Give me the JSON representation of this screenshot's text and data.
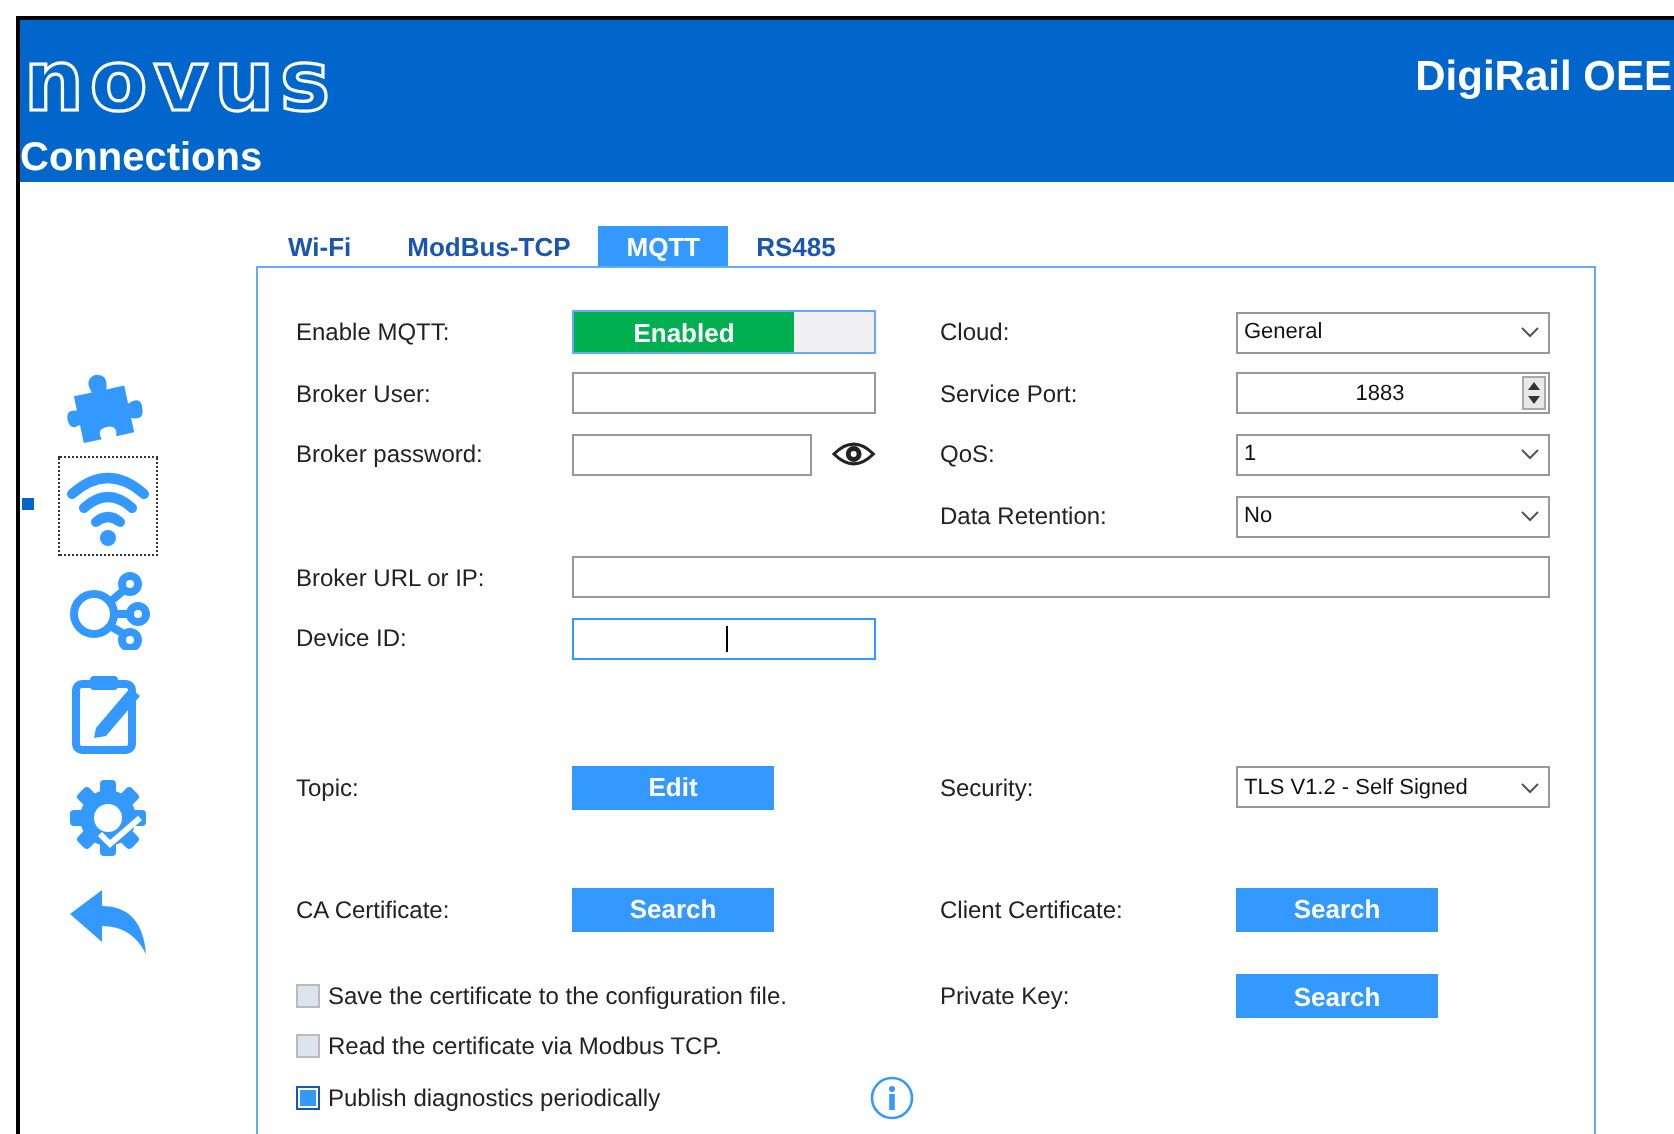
{
  "header": {
    "logo": "novus",
    "product": "DigiRail OEE",
    "page_title": "Connections"
  },
  "sidebar": {
    "items": [
      {
        "kind": "puzzle",
        "selected": false
      },
      {
        "kind": "wifi",
        "selected": true
      },
      {
        "kind": "nodes",
        "selected": false
      },
      {
        "kind": "clipboard",
        "selected": false
      },
      {
        "kind": "gear",
        "selected": false
      },
      {
        "kind": "back",
        "selected": false
      }
    ]
  },
  "tabs": [
    {
      "label": "Wi-Fi",
      "selected": false
    },
    {
      "label": "ModBus-TCP",
      "selected": false
    },
    {
      "label": "MQTT",
      "selected": true
    },
    {
      "label": "RS485",
      "selected": false
    }
  ],
  "form": {
    "rows": [
      {
        "left": {
          "kind": "toggle",
          "label": "Enable MQTT:",
          "value": "Enabled",
          "on": true
        },
        "right": {
          "kind": "select",
          "label": "Cloud:",
          "value": "General"
        }
      },
      {
        "left": {
          "kind": "text",
          "label": "Broker User:",
          "focused": false
        },
        "right": {
          "kind": "spin",
          "label": "Service Port:",
          "value": "1883"
        }
      },
      {
        "left": {
          "kind": "password",
          "label": "Broker password:"
        },
        "right": {
          "kind": "select",
          "label": "QoS:",
          "value": "1"
        }
      },
      {
        "right": {
          "kind": "select",
          "label": "Data Retention:",
          "value": "No"
        }
      },
      {
        "left": {
          "kind": "wide",
          "label": "Broker URL or IP:"
        }
      },
      {
        "left": {
          "kind": "text",
          "label": "Device ID:",
          "focused": true
        }
      },
      {
        "left": {
          "kind": "button",
          "label": "Topic:",
          "button": "Edit"
        },
        "right": {
          "kind": "select",
          "label": "Security:",
          "value": "TLS V1.2 - Self Signed"
        }
      },
      {
        "left": {
          "kind": "button",
          "label": "CA Certificate:",
          "button": "Search"
        },
        "right": {
          "kind": "button",
          "label": "Client Certificate:",
          "button": "Search"
        }
      },
      {
        "left": {
          "kind": "checkbox",
          "label": "Save the certificate to the configuration file.",
          "checked": false
        },
        "right": {
          "kind": "button",
          "label": "Private Key:",
          "button": "Search"
        }
      },
      {
        "left": {
          "kind": "checkbox",
          "label": "Read the certificate via Modbus TCP.",
          "checked": false
        }
      },
      {
        "left": {
          "kind": "checkbox",
          "label": "Publish diagnostics periodically",
          "checked": true,
          "info": true
        }
      }
    ]
  }
}
